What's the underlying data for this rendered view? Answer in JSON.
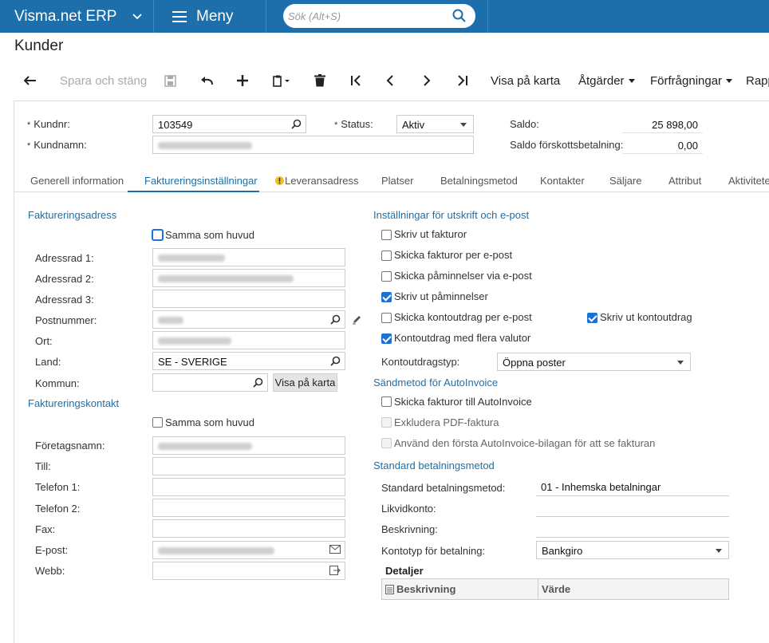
{
  "app": {
    "brand": "Visma.net ERP",
    "menu": "Meny",
    "search_placeholder": "Sök (Alt+S)"
  },
  "page": {
    "title": "Kunder"
  },
  "toolbar": {
    "save_close": "Spara och stäng",
    "map": "Visa på karta",
    "actions": "Åtgärder",
    "inquiries": "Förfrågningar",
    "reports": "Rapp"
  },
  "header": {
    "kundnr_label": "Kundnr:",
    "kundnr_value": "103549",
    "kundnamn_label": "Kundnamn:",
    "status_label": "Status:",
    "status_value": "Aktiv",
    "saldo_label": "Saldo:",
    "saldo_value": "25 898,00",
    "saldo_forskott_label": "Saldo förskottsbetalning:",
    "saldo_forskott_value": "0,00"
  },
  "tabs": [
    "Generell information",
    "Faktureringsinställningar",
    "Leveransadress",
    "Platser",
    "Betalningsmetod",
    "Kontakter",
    "Säljare",
    "Attribut",
    "Aktiviteter"
  ],
  "billing_address": {
    "section": "Faktureringsadress",
    "same_as_main": "Samma som huvud",
    "adr1_label": "Adressrad 1:",
    "adr2_label": "Adressrad 2:",
    "adr3_label": "Adressrad 3:",
    "postnr_label": "Postnummer:",
    "ort_label": "Ort:",
    "land_label": "Land:",
    "land_value": "SE - SVERIGE",
    "kommun_label": "Kommun:",
    "map_button": "Visa på karta"
  },
  "billing_contact": {
    "section": "Faktureringskontakt",
    "same_as_main": "Samma som huvud",
    "company_label": "Företagsnamn:",
    "attn_label": "Till:",
    "phone1_label": "Telefon 1:",
    "phone2_label": "Telefon 2:",
    "fax_label": "Fax:",
    "email_label": "E-post:",
    "web_label": "Webb:"
  },
  "print_email": {
    "section": "Inställningar för utskrift och e-post",
    "print_invoices": "Skriv ut fakturor",
    "email_invoices": "Skicka fakturor per e-post",
    "email_reminders": "Skicka påminnelser via e-post",
    "print_reminders": "Skriv ut påminnelser",
    "email_statements": "Skicka kontoutdrag per e-post",
    "print_statements": "Skriv ut kontoutdrag",
    "multi_currency": "Kontoutdrag med flera valutor",
    "statement_type_label": "Kontoutdragstyp:",
    "statement_type_value": "Öppna poster"
  },
  "autoinvoice": {
    "section": "Sändmetod för AutoInvoice",
    "send": "Skicka fakturor till AutoInvoice",
    "exclude_pdf": "Exkludera PDF-faktura",
    "use_first": "Använd den första AutoInvoice-bilagan för att se fakturan"
  },
  "payment": {
    "section": "Standard betalningsmetod",
    "method_label": "Standard betalningsmetod:",
    "method_value": "01 - Inhemska betalningar",
    "cash_account_label": "Likvidkonto:",
    "description_label": "Beskrivning:",
    "account_type_label": "Kontotyp för betalning:",
    "account_type_value": "Bankgiro",
    "details": "Detaljer",
    "col_description": "Beskrivning",
    "col_value": "Värde"
  }
}
